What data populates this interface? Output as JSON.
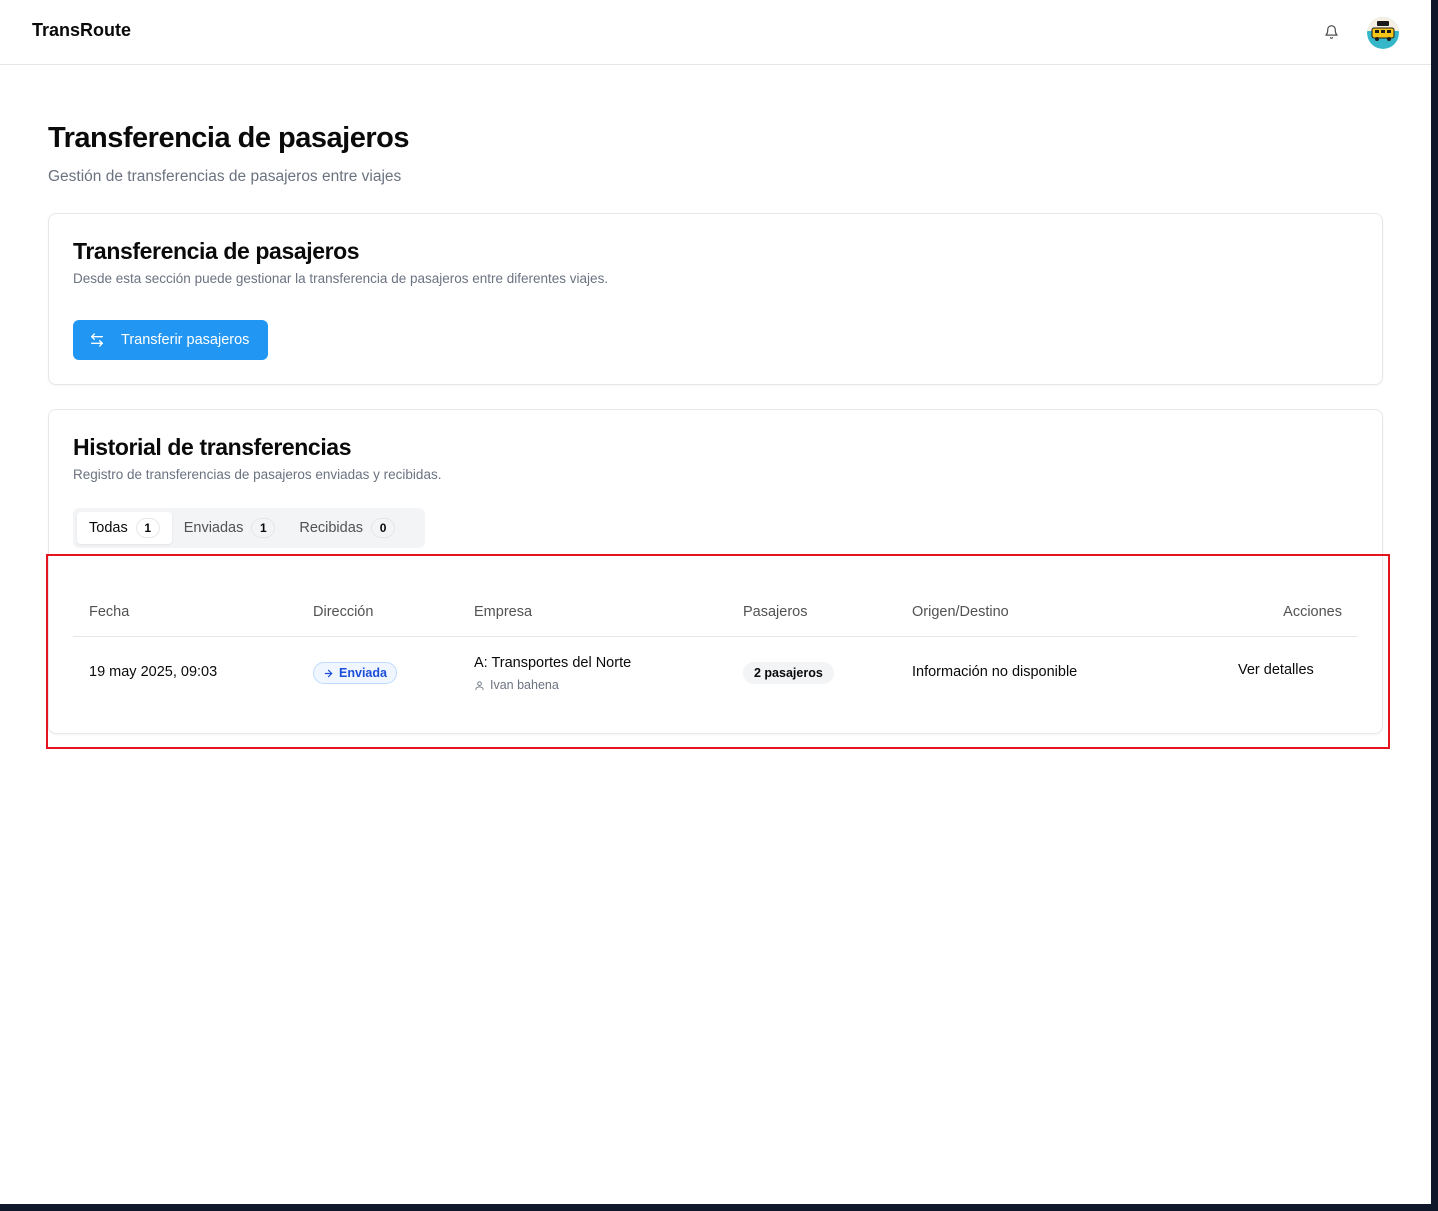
{
  "app": {
    "brand": "TransRoute"
  },
  "header": {
    "title": "Transferencia de pasajeros",
    "subtitle": "Gestión de transferencias de pasajeros entre viajes"
  },
  "transfer_card": {
    "title": "Transferencia de pasajeros",
    "description": "Desde esta sección puede gestionar la transferencia de pasajeros entre diferentes viajes.",
    "button_label": "Transferir pasajeros"
  },
  "history_card": {
    "title": "Historial de transferencias",
    "description": "Registro de transferencias de pasajeros enviadas y recibidas.",
    "tabs": [
      {
        "label": "Todas",
        "count": "1"
      },
      {
        "label": "Enviadas",
        "count": "1"
      },
      {
        "label": "Recibidas",
        "count": "0"
      }
    ],
    "table": {
      "columns": [
        "Fecha",
        "Dirección",
        "Empresa",
        "Pasajeros",
        "Origen/Destino",
        "Acciones"
      ],
      "rows": [
        {
          "date": "19 may 2025, 09:03",
          "direction": "Enviada",
          "company": "A: Transportes del Norte",
          "user": "Ivan bahena",
          "passengers": "2 pasajeros",
          "origin_destination": "Información no disponible",
          "action": "Ver detalles"
        }
      ]
    }
  },
  "colors": {
    "primary": "#2196f3",
    "direction_badge": "#1d4ed8",
    "highlight": "#e5131d"
  }
}
